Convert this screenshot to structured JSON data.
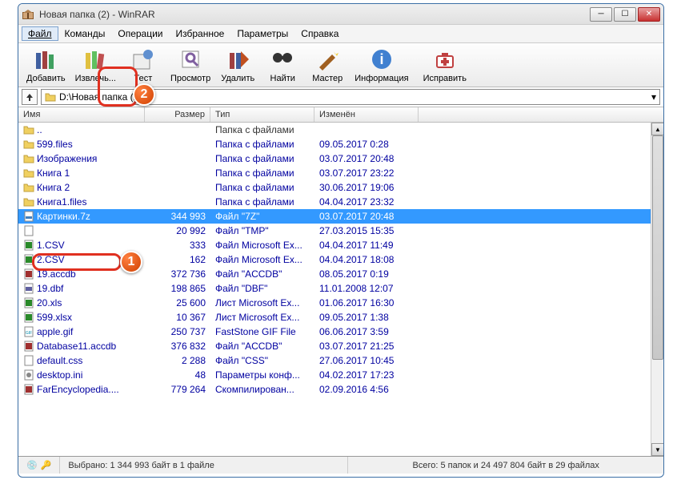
{
  "window": {
    "title": "Новая папка (2) - WinRAR"
  },
  "menu": [
    "Файл",
    "Команды",
    "Операции",
    "Избранное",
    "Параметры",
    "Справка"
  ],
  "toolbar": [
    {
      "id": "add",
      "label": "Добавить"
    },
    {
      "id": "extract",
      "label": "Извлечь..."
    },
    {
      "id": "test",
      "label": "Тест"
    },
    {
      "id": "view",
      "label": "Просмотр"
    },
    {
      "id": "delete",
      "label": "Удалить"
    },
    {
      "id": "find",
      "label": "Найти"
    },
    {
      "id": "wizard",
      "label": "Мастер"
    },
    {
      "id": "info",
      "label": "Информация"
    },
    {
      "id": "repair",
      "label": "Исправить"
    }
  ],
  "path": "D:\\Новая папка (2)",
  "columns": {
    "name": "Имя",
    "size": "Размер",
    "type": "Тип",
    "mod": "Изменён"
  },
  "rows": [
    {
      "icon": "folder",
      "name": "..",
      "size": "",
      "type": "Папка с файлами",
      "mod": "",
      "parent": true
    },
    {
      "icon": "folder",
      "name": "599.files",
      "size": "",
      "type": "Папка с файлами",
      "mod": "09.05.2017 0:28"
    },
    {
      "icon": "folder",
      "name": "Изображения",
      "size": "",
      "type": "Папка с файлами",
      "mod": "03.07.2017 20:48"
    },
    {
      "icon": "folder",
      "name": "Книга 1",
      "size": "",
      "type": "Папка с файлами",
      "mod": "03.07.2017 23:22"
    },
    {
      "icon": "folder",
      "name": "Книга 2",
      "size": "",
      "type": "Папка с файлами",
      "mod": "30.06.2017 19:06"
    },
    {
      "icon": "folder",
      "name": "Книга1.files",
      "size": "",
      "type": "Папка с файлами",
      "mod": "04.04.2017 23:32"
    },
    {
      "icon": "7z",
      "name": "Картинки.7z",
      "size": "344 993",
      "type": "Файл \"7Z\"",
      "mod": "03.07.2017 20:48",
      "sel": true
    },
    {
      "icon": "tmp",
      "name": "",
      "size": "20 992",
      "type": "Файл \"TMP\"",
      "mod": "27.03.2015 15:35"
    },
    {
      "icon": "xls",
      "name": "1.CSV",
      "size": "333",
      "type": "Файл Microsoft Ex...",
      "mod": "04.04.2017 11:49"
    },
    {
      "icon": "xls",
      "name": "2.CSV",
      "size": "162",
      "type": "Файл Microsoft Ex...",
      "mod": "04.04.2017 18:08"
    },
    {
      "icon": "accdb",
      "name": "19.accdb",
      "size": "372 736",
      "type": "Файл \"ACCDB\"",
      "mod": "08.05.2017 0:19"
    },
    {
      "icon": "dbf",
      "name": "19.dbf",
      "size": "198 865",
      "type": "Файл \"DBF\"",
      "mod": "11.01.2008 12:07"
    },
    {
      "icon": "xls",
      "name": "20.xls",
      "size": "25 600",
      "type": "Лист Microsoft Ex...",
      "mod": "01.06.2017 16:30"
    },
    {
      "icon": "xls",
      "name": "599.xlsx",
      "size": "10 367",
      "type": "Лист Microsoft Ex...",
      "mod": "09.05.2017 1:38"
    },
    {
      "icon": "gif",
      "name": "apple.gif",
      "size": "250 737",
      "type": "FastStone GIF File",
      "mod": "06.06.2017 3:59"
    },
    {
      "icon": "accdb",
      "name": "Database11.accdb",
      "size": "376 832",
      "type": "Файл \"ACCDB\"",
      "mod": "03.07.2017 21:25"
    },
    {
      "icon": "css",
      "name": "default.css",
      "size": "2 288",
      "type": "Файл \"CSS\"",
      "mod": "27.06.2017 10:45"
    },
    {
      "icon": "ini",
      "name": "desktop.ini",
      "size": "48",
      "type": "Параметры конф...",
      "mod": "04.02.2017 17:23"
    },
    {
      "icon": "accdb",
      "name": "FarEncyclopedia....",
      "size": "779 264",
      "type": "Скомпилирован...",
      "mod": "02.09.2016 4:56"
    }
  ],
  "status": {
    "left": "Выбрано: 1 344 993 байт в 1 файле",
    "right": "Всего: 5 папок и 24 497 804 байт в 29 файлах"
  },
  "markers": {
    "1": "1",
    "2": "2"
  }
}
